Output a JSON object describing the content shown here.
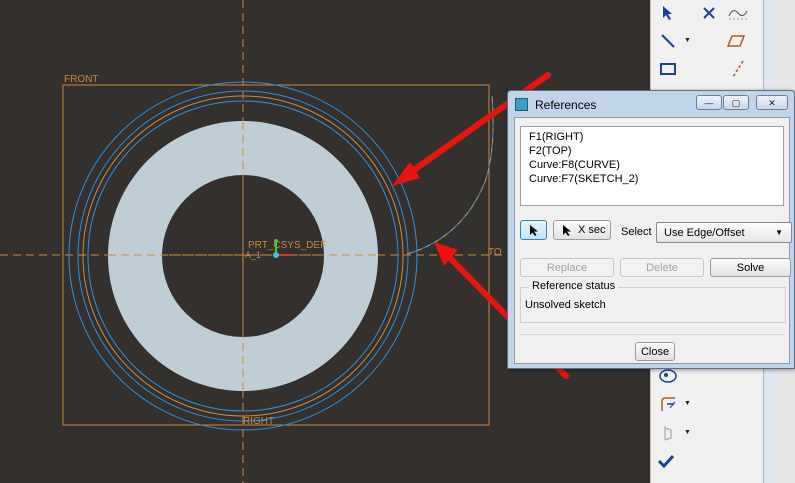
{
  "canvas": {
    "labels": {
      "front": "FRONT",
      "right": "RIGHT",
      "top_partial": "TO",
      "csys": "PRT_CSYS_DEF",
      "axis": "A_1"
    }
  },
  "toolbar": {
    "icons": [
      "select-arrow-icon",
      "delete-x-icon",
      "spline-icon",
      "line-icon",
      "parallelogram-icon",
      "rectangle-icon",
      "centerline-icon",
      "palette-icon",
      "trim-icon",
      "modify-icon",
      "checkmark-icon"
    ]
  },
  "dialog": {
    "title": "References",
    "window_buttons": {
      "minimize": "—",
      "maximize": "▢",
      "close": "✕"
    },
    "references": [
      "F1(RIGHT)",
      "F2(TOP)",
      "Curve:F8(CURVE)",
      "Curve:F7(SKETCH_2)"
    ],
    "xsec_label": "X sec",
    "select_label": "Select",
    "select_value": "Use Edge/Offset",
    "replace_label": "Replace",
    "delete_label": "Delete",
    "solve_label": "Solve",
    "status_title": "Reference status",
    "status_value": "Unsolved sketch",
    "close_label": "Close"
  },
  "colors": {
    "background": "#33302d",
    "datum": "#c8883c",
    "circle": "#2f8fe0",
    "ring_fill": "#bfcdd7",
    "callout_arrow": "#e8150e"
  }
}
